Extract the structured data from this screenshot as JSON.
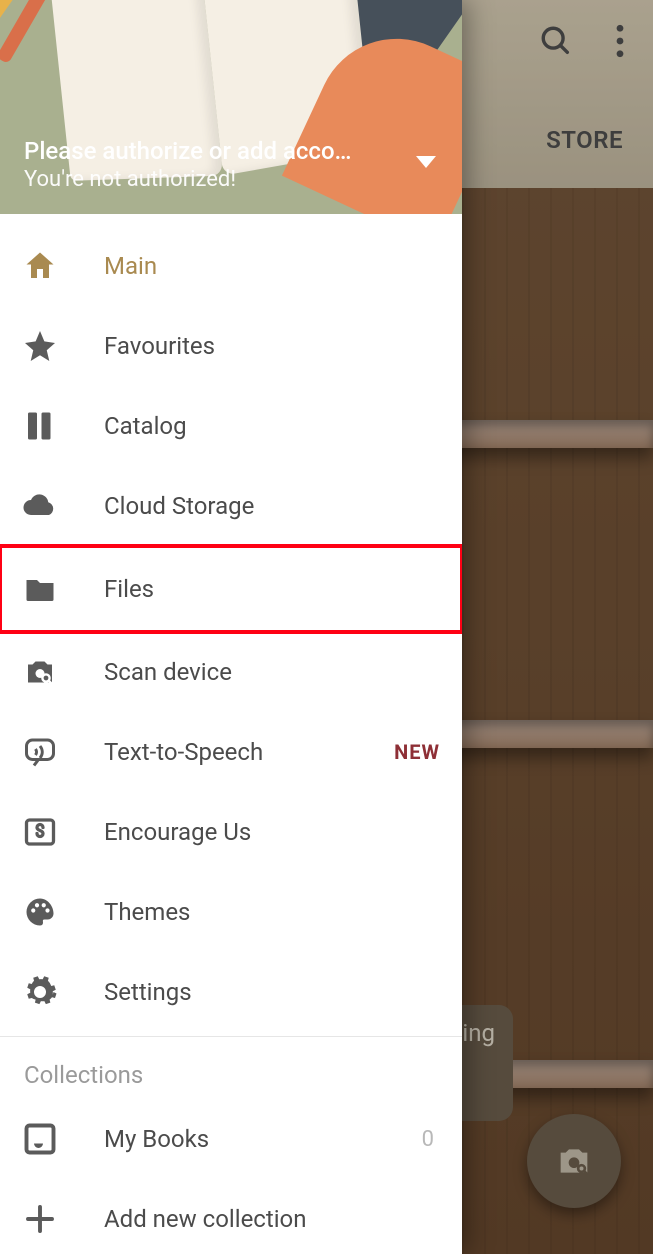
{
  "appbar": {
    "store_tab": "STORE"
  },
  "drawer_header": {
    "line1": "Please authorize or add acco…",
    "line2": "You're not authorized!"
  },
  "nav": {
    "main": "Main",
    "favourites": "Favourites",
    "catalog": "Catalog",
    "cloud": "Cloud Storage",
    "files": "Files",
    "scan": "Scan device",
    "tts": "Text-to-Speech",
    "tts_badge": "NEW",
    "encourage": "Encourage Us",
    "themes": "Themes",
    "settings": "Settings"
  },
  "collections": {
    "title": "Collections",
    "mybooks": "My Books",
    "mybooks_count": "0",
    "add": "Add new collection"
  },
  "bubble_text": "hing"
}
